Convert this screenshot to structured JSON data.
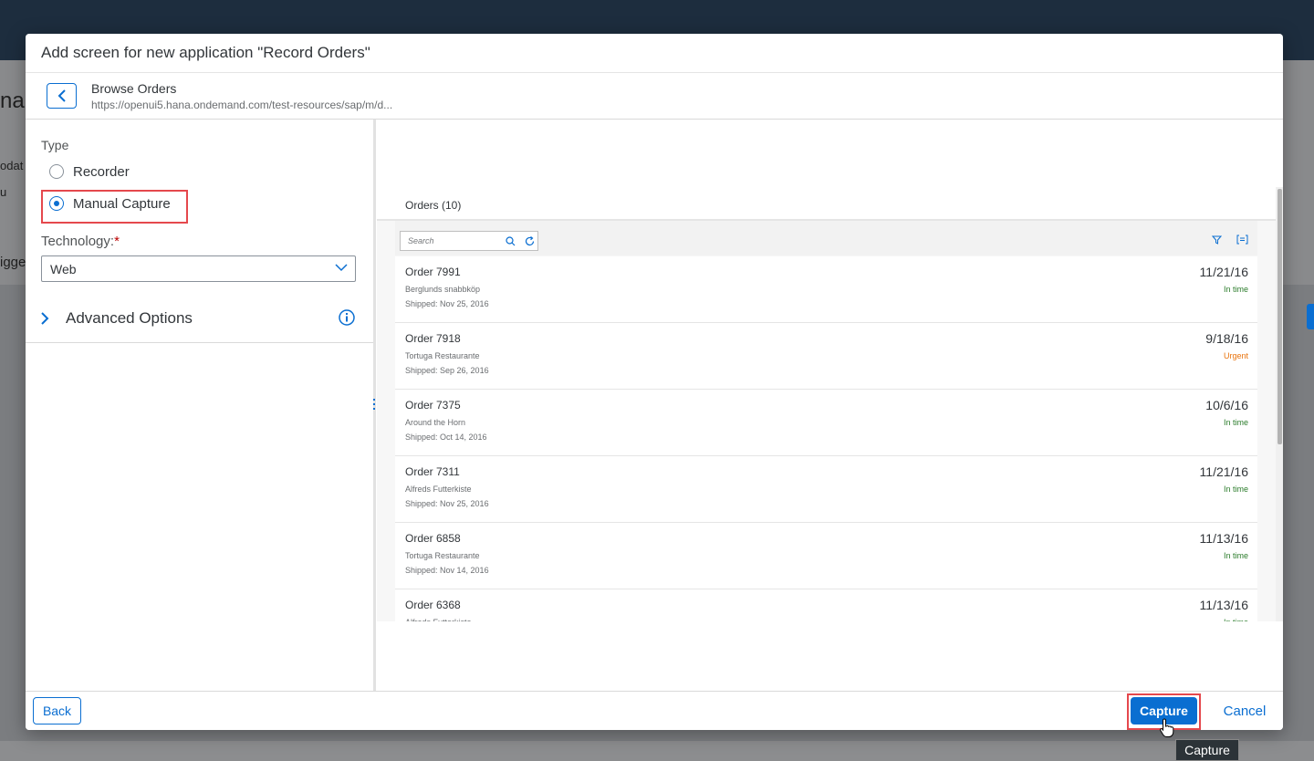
{
  "background": {
    "text_fragments": [
      "na",
      "odat",
      "u",
      "igge"
    ]
  },
  "dialog": {
    "title": "Add screen for new application \"Record Orders\"",
    "subheader": {
      "title": "Browse Orders",
      "url": "https://openui5.hana.ondemand.com/test-resources/sap/m/d..."
    },
    "type_section": {
      "label": "Type",
      "options": [
        {
          "label": "Recorder",
          "selected": false
        },
        {
          "label": "Manual Capture",
          "selected": true
        }
      ]
    },
    "technology": {
      "label": "Technology:",
      "required_marker": "*",
      "value": "Web"
    },
    "advanced_options": {
      "label": "Advanced Options"
    },
    "preview": {
      "list_title": "Orders (10)",
      "search_placeholder": "Search",
      "orders": [
        {
          "id": "Order 7991",
          "customer": "Berglunds snabbköp",
          "shipped": "Shipped: Nov 25, 2016",
          "date": "11/21/16",
          "status": "In time",
          "status_color": "#2b7c2b"
        },
        {
          "id": "Order 7918",
          "customer": "Tortuga Restaurante",
          "shipped": "Shipped: Sep 26, 2016",
          "date": "9/18/16",
          "status": "Urgent",
          "status_color": "#e9730c"
        },
        {
          "id": "Order 7375",
          "customer": "Around the Horn",
          "shipped": "Shipped: Oct 14, 2016",
          "date": "10/6/16",
          "status": "In time",
          "status_color": "#2b7c2b"
        },
        {
          "id": "Order 7311",
          "customer": "Alfreds Futterkiste",
          "shipped": "Shipped: Nov 25, 2016",
          "date": "11/21/16",
          "status": "In time",
          "status_color": "#2b7c2b"
        },
        {
          "id": "Order 6858",
          "customer": "Tortuga Restaurante",
          "shipped": "Shipped: Nov 14, 2016",
          "date": "11/13/16",
          "status": "In time",
          "status_color": "#2b7c2b"
        },
        {
          "id": "Order 6368",
          "customer": "Alfreds Futterkiste",
          "shipped": "",
          "date": "11/13/16",
          "status": "In time",
          "status_color": "#2b7c2b"
        }
      ]
    },
    "footer": {
      "back_label": "Back",
      "capture_label": "Capture",
      "cancel_label": "Cancel"
    }
  },
  "tooltip": {
    "text": "Capture"
  },
  "colors": {
    "accent": "#0a6ed1",
    "highlight": "#e5484d",
    "shell": "#1d2d3e"
  }
}
